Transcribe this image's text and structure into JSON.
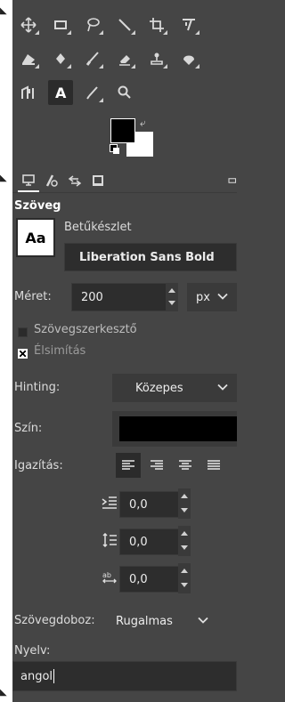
{
  "panel_title": "Szöveg",
  "font": {
    "preview_label": "Aa",
    "section_label": "Betűkészlet",
    "value": "Liberation Sans Bold"
  },
  "size": {
    "label": "Méret:",
    "value": "200",
    "unit": "px"
  },
  "options": {
    "editor_label": "Szövegszerkesztő",
    "editor_checked": false,
    "antialias_label": "Élsimítás",
    "antialias_checked": true
  },
  "hinting": {
    "label": "Hinting:",
    "value": "Közepes"
  },
  "color": {
    "label": "Szín:",
    "value": "#000000"
  },
  "justify": {
    "label": "Igazítás:"
  },
  "indent": {
    "value": "0,0"
  },
  "line_spacing": {
    "value": "0,0"
  },
  "letter_spacing": {
    "value": "0,0"
  },
  "box": {
    "label": "Szövegdoboz:",
    "value": "Rugalmas"
  },
  "language": {
    "label": "Nyelv:",
    "value": "angol"
  }
}
